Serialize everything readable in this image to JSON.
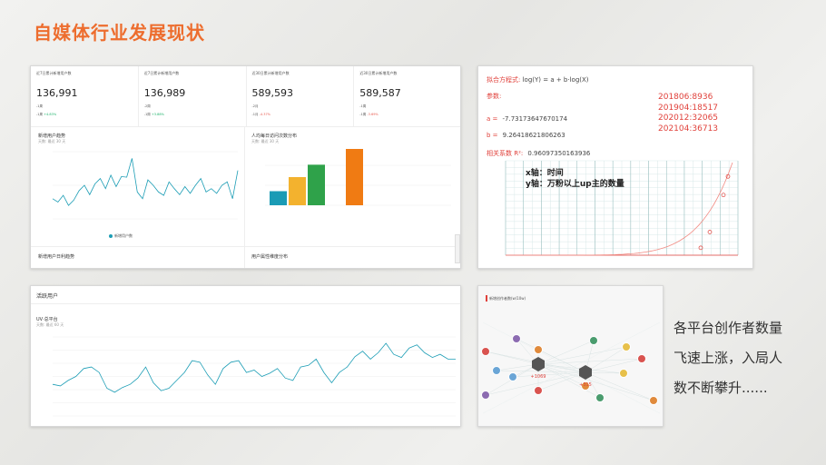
{
  "slide": {
    "title": "自媒体行业发展现状",
    "summary_lines": [
      "各平台创作者数量",
      "飞速上涨，入局人",
      "数不断攀升......"
    ]
  },
  "dashboard1": {
    "stats": [
      {
        "label": "近7日累计新增用户数",
        "value": "136,991",
        "r1": "-1周",
        "r2": "-1周",
        "p": "+4.83%",
        "trend": "up"
      },
      {
        "label": "近7日累计新增用户数",
        "value": "136,989",
        "r1": "-2周",
        "r2": "-1周",
        "p": "+3.88%",
        "trend": "up"
      },
      {
        "label": "近30日累计新增用户数",
        "value": "589,593",
        "r1": "-2月",
        "r2": "-1月",
        "p": "-4.37%",
        "trend": "down"
      },
      {
        "label": "近30日累计新增用户数",
        "value": "589,587",
        "r1": "-1周",
        "r2": "-1周",
        "p": "-3.69%",
        "trend": "down"
      }
    ],
    "line_title": "新增用户趋势",
    "line_sub": "天数: 最近 30 天",
    "line_legend": "新增用户数",
    "bar_title": "人均每日访问次数分布",
    "bar_sub": "天数: 最近 30 天",
    "bottom_left_title": "新增用户日利趋势",
    "bottom_right_title": "用户属性维度分布"
  },
  "dashboard2": {
    "header": "活跃用户",
    "title": "UV·总平台",
    "sub": "天数: 最近 60 天"
  },
  "regression": {
    "formula_label": "拟合方程式:",
    "formula": "log(Y) = a + b·log(X)",
    "params_label": "参数:",
    "a_label": "a =",
    "a_value": "-7.73173647670174",
    "b_label": "b =",
    "b_value": "9.26418621806263",
    "corr_label": "相关系数 R²:",
    "corr_value": "0.96097350163936",
    "data_points": [
      "201806:8936",
      "201904:18517",
      "202012:32065",
      "202104:36713"
    ],
    "x_axis_note": "x轴：时间",
    "y_axis_note": "y轴：万粉以上up主的数量"
  },
  "network": {
    "title": "新增创作者数(w/10w)",
    "labels": [
      "+1069",
      "+315"
    ]
  },
  "colors": {
    "accent": "#ed6d2e",
    "teal": "#1c9db5",
    "bar_teal": "#1a9bb5",
    "bar_yellow": "#f3b22e",
    "bar_green": "#2fa24a",
    "bar_orange": "#f07b13"
  }
}
